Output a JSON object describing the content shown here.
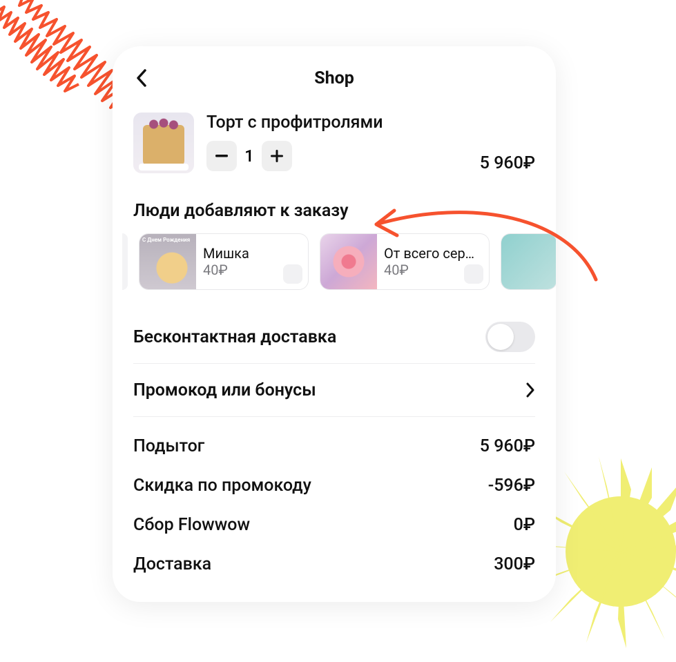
{
  "header": {
    "title": "Shop"
  },
  "cart": {
    "item": {
      "name": "Торт с профитролями",
      "quantity": "1",
      "price": "5 960₽"
    }
  },
  "suggestions": {
    "heading": "Люди добавляют к заказу",
    "items": [
      {
        "name": "Мишка",
        "price": "40₽",
        "thumb_text": "С Днем\nРождения"
      },
      {
        "name": "От всего серд…",
        "price": "40₽"
      }
    ]
  },
  "contactless": {
    "label": "Бесконтактная доставка",
    "enabled": false
  },
  "promo": {
    "label": "Промокод или бонусы"
  },
  "totals": [
    {
      "label": "Подытог",
      "value": "5 960₽"
    },
    {
      "label": "Скидка по промокоду",
      "value": "-596₽"
    },
    {
      "label": "Сбор Flowwow",
      "value": "0₽"
    },
    {
      "label": "Доставка",
      "value": "300₽"
    }
  ]
}
